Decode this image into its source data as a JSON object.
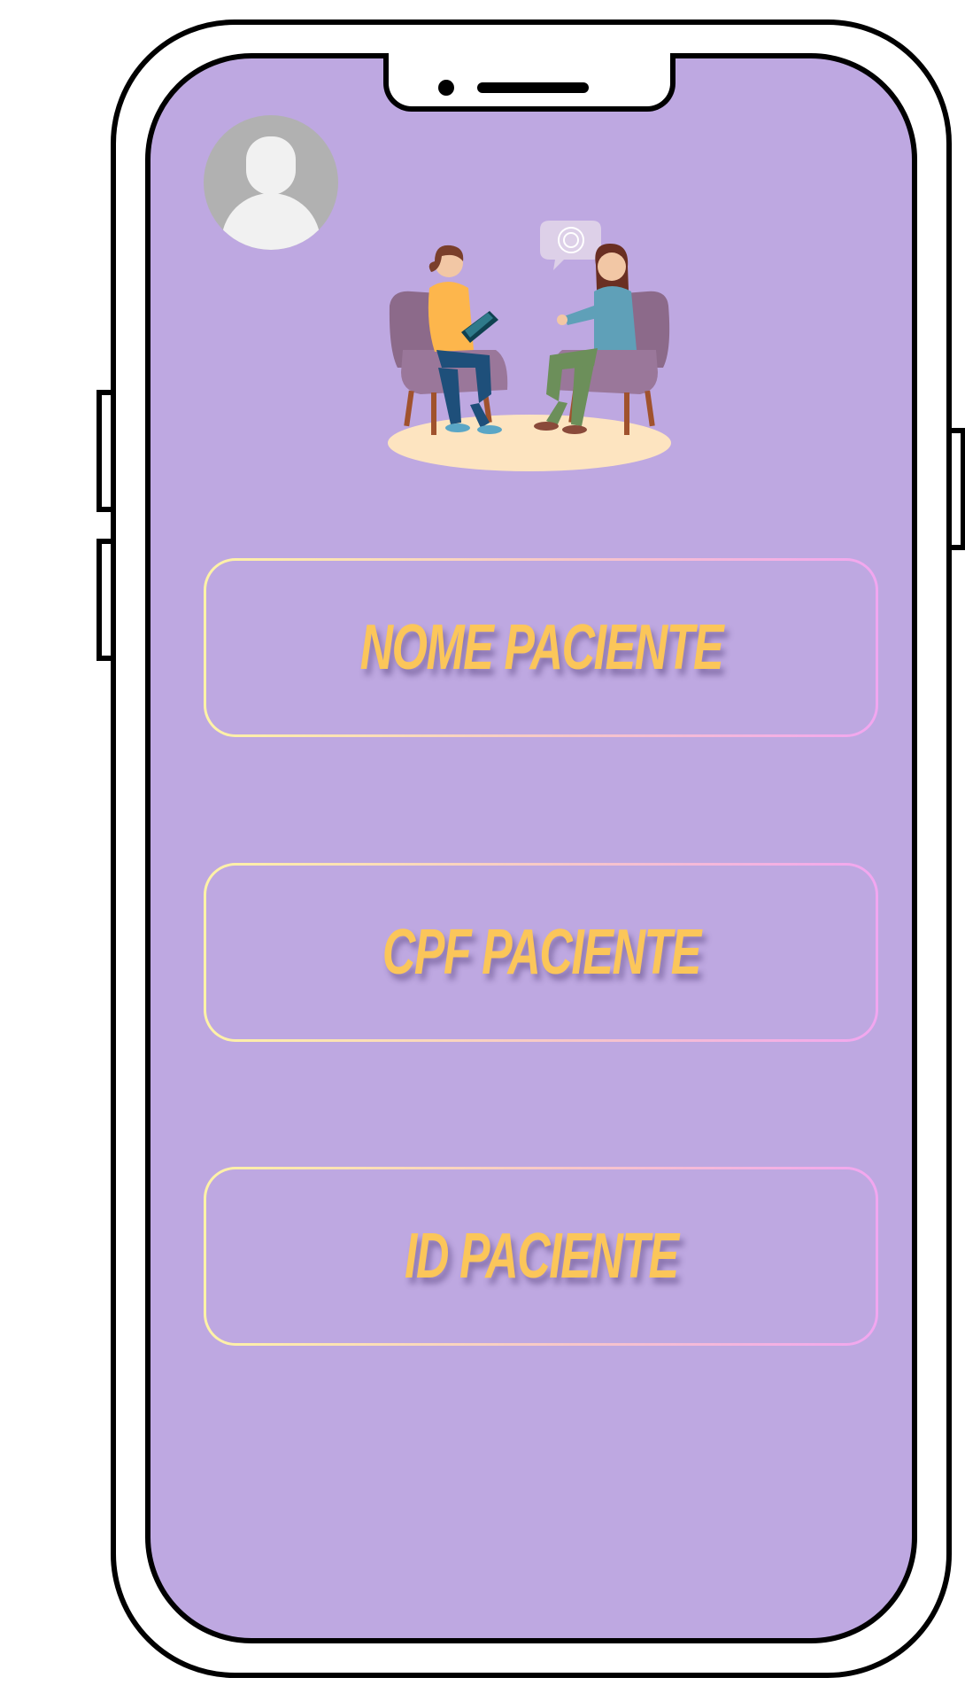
{
  "fields": [
    {
      "label": "NOME PACIENTE"
    },
    {
      "label": "CPF PACIENTE"
    },
    {
      "label": "ID PACIENTE"
    }
  ],
  "colors": {
    "screen_background": "#bea8e1",
    "label": "#fbc65a",
    "border_gradient_start": "#fff3a6",
    "border_gradient_end": "#f2a6f0",
    "frame": "#000000"
  },
  "icons": {
    "avatar": "user-avatar-icon",
    "illustration": "therapy-session-illustration"
  }
}
